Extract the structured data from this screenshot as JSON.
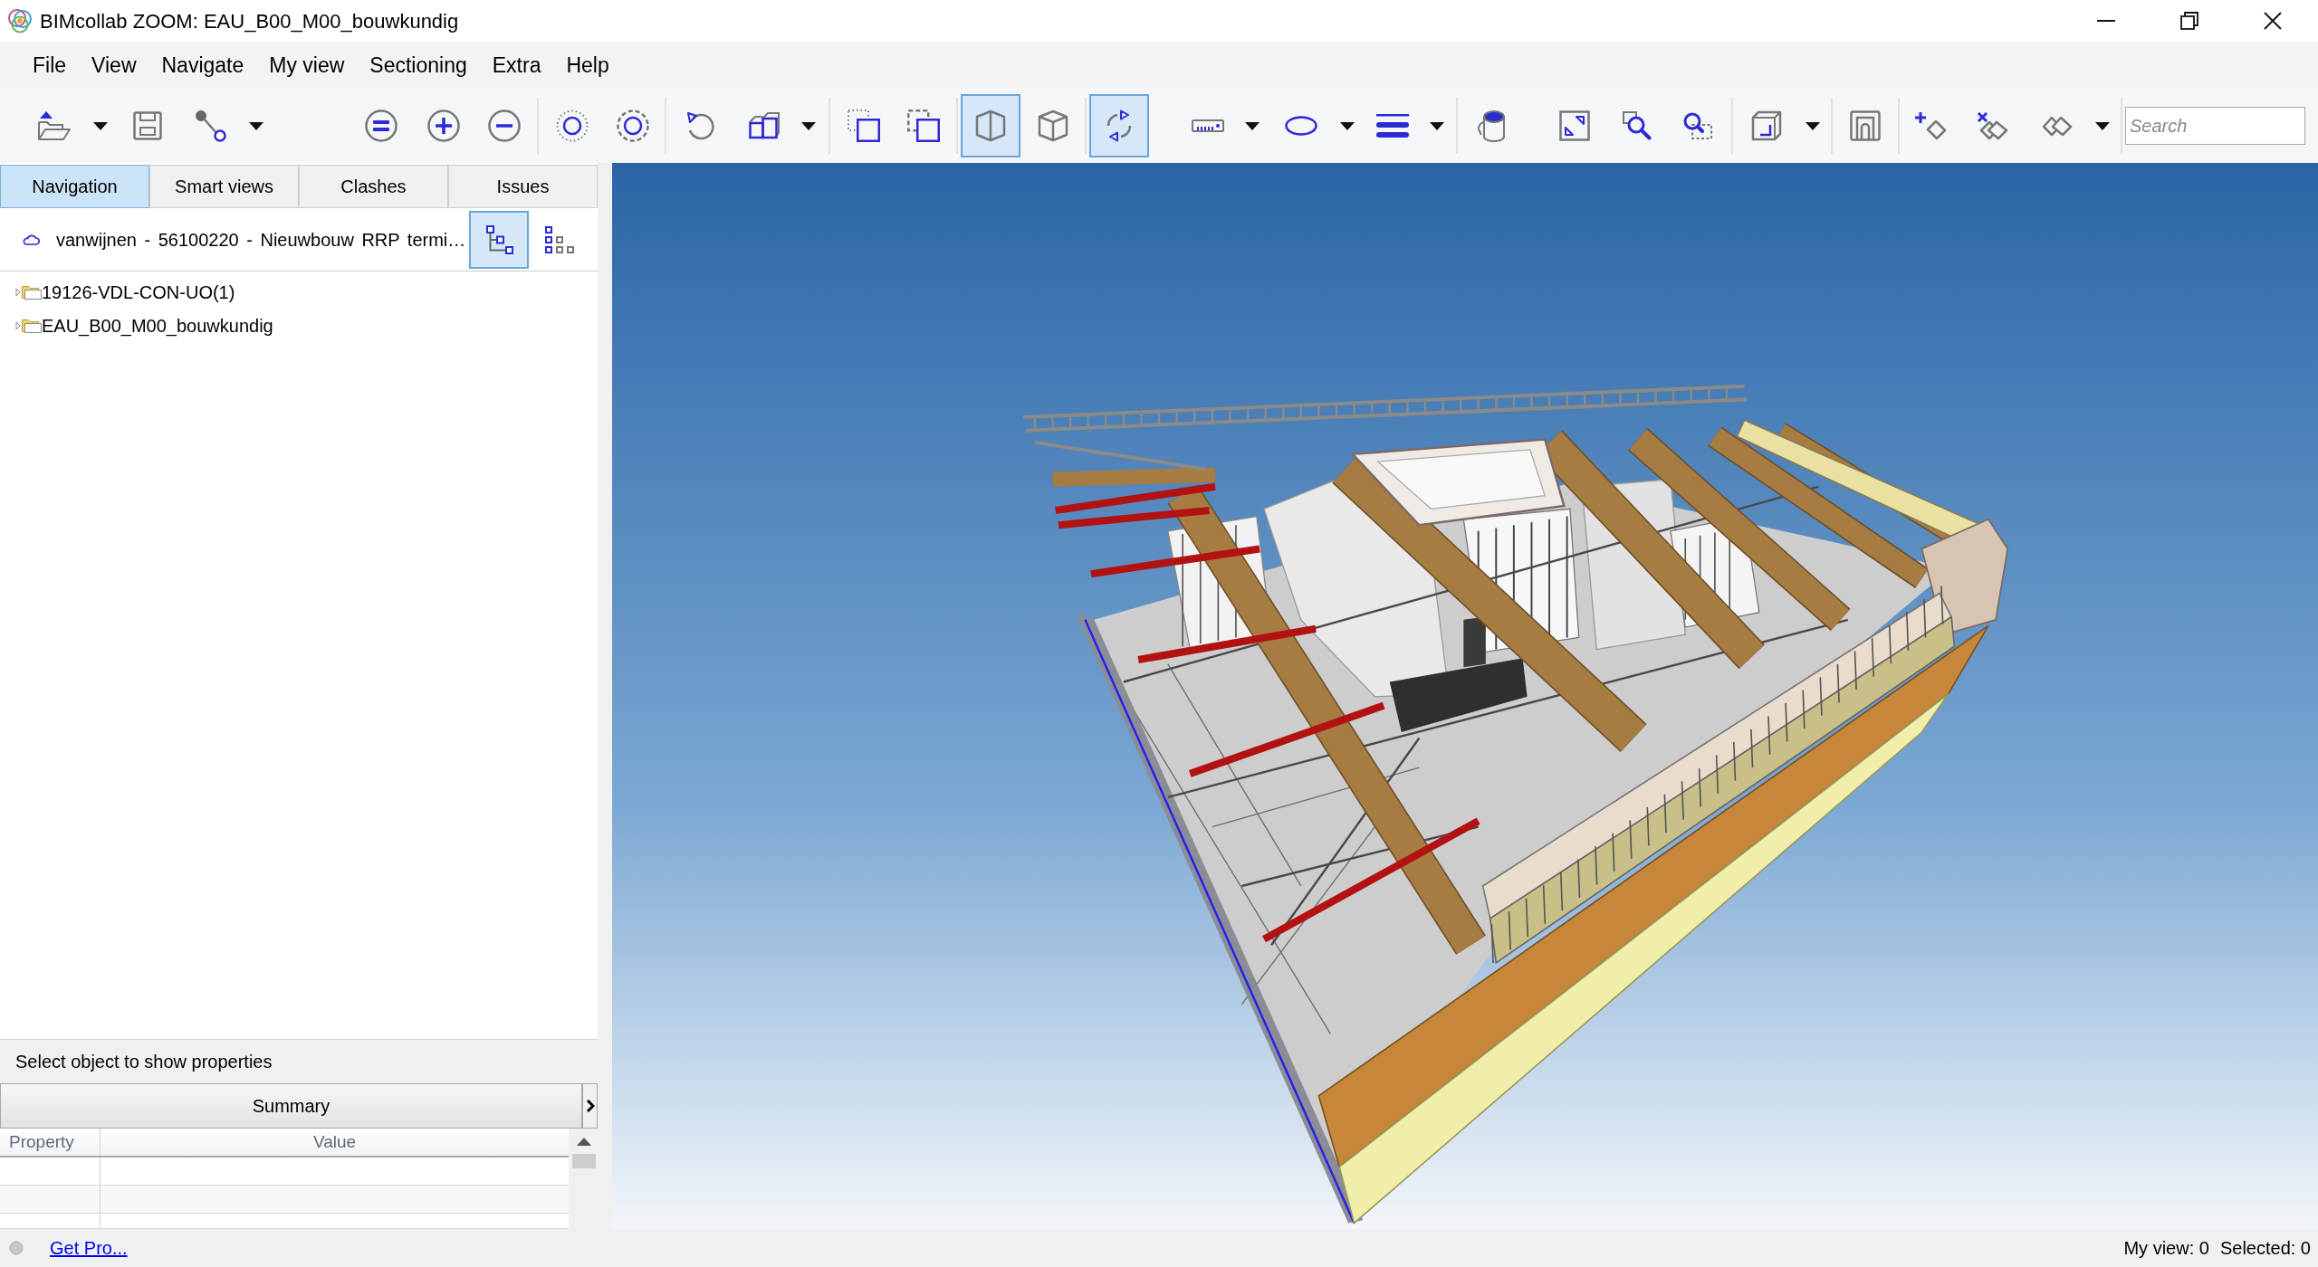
{
  "window": {
    "title": "BIMcollab ZOOM: EAU_B00_M00_bouwkundig"
  },
  "menu": [
    "File",
    "View",
    "Navigate",
    "My view",
    "Sectioning",
    "Extra",
    "Help"
  ],
  "toolbar": {
    "buttons": [
      {
        "on": false
      },
      {
        "on": false
      },
      {
        "on": false
      },
      {
        "on": false
      },
      {
        "on": false
      },
      {
        "on": false
      },
      {
        "on": false
      },
      {
        "on": false
      },
      {
        "on": false
      },
      {
        "on": false
      },
      {
        "on": false
      },
      {
        "on": false
      },
      {
        "on": true
      },
      {
        "on": false
      },
      {
        "on": true
      },
      {
        "on": false
      },
      {
        "on": false
      },
      {
        "on": false
      },
      {
        "on": false
      },
      {
        "on": false
      },
      {
        "on": false
      },
      {
        "on": false
      },
      {
        "on": false
      },
      {
        "on": false
      },
      {
        "on": false
      },
      {
        "on": false
      },
      {
        "on": false
      }
    ],
    "search": {
      "placeholder": "Search"
    }
  },
  "tabs": [
    {
      "label": "Navigation",
      "selected": true
    },
    {
      "label": "Smart views",
      "selected": false
    },
    {
      "label": "Clashes",
      "selected": false
    },
    {
      "label": "Issues",
      "selected": false
    }
  ],
  "project": {
    "name": "vanwijnen - 56100220 - Nieuwbouw RRP termi…",
    "view_modes": [
      {
        "selected": true
      },
      {
        "selected": false
      }
    ]
  },
  "tree": [
    {
      "label": "19126-VDL-CON-UO(1)",
      "expanded": false
    },
    {
      "label": "EAU_B00_M00_bouwkundig",
      "expanded": false
    }
  ],
  "properties": {
    "hint": "Select object to show properties",
    "summary": "Summary",
    "columns": [
      "Property",
      "Value"
    ]
  },
  "status_bar": {
    "link": "Get Pro...",
    "my_view": "My view: 0",
    "selected": "Selected: 0"
  }
}
